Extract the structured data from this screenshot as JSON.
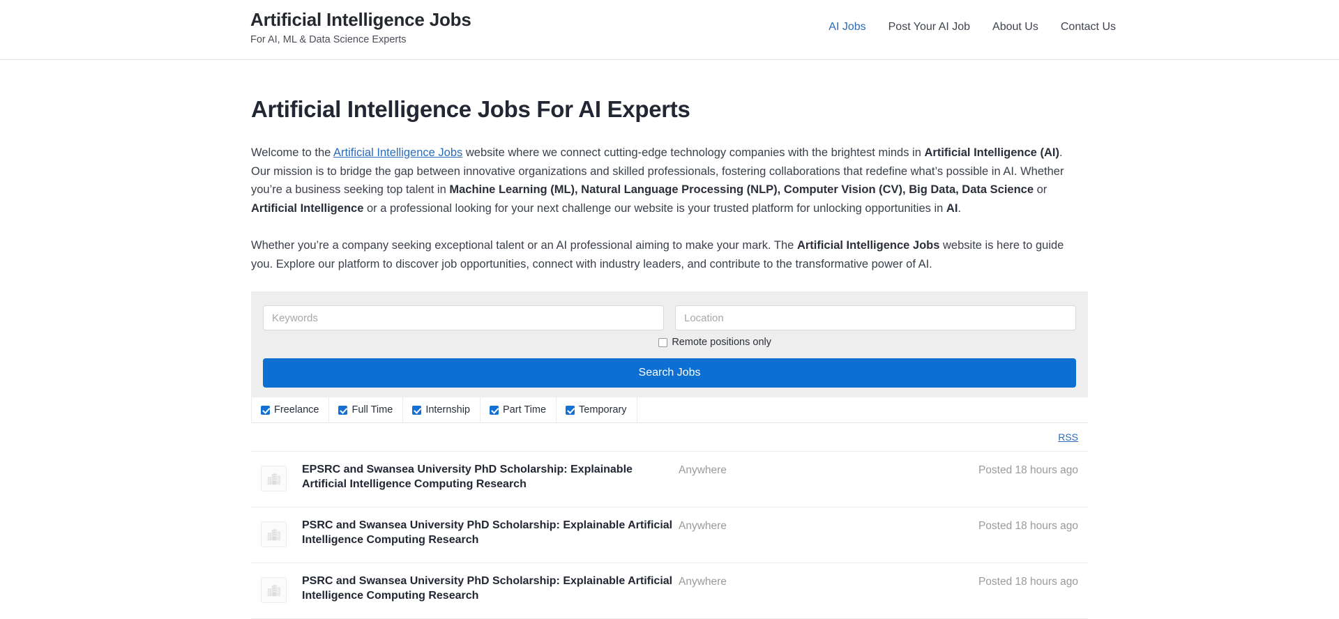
{
  "header": {
    "brand_title": "Artificial Intelligence Jobs",
    "brand_tagline": "For AI, ML & Data Science Experts",
    "nav": [
      {
        "label": "AI Jobs",
        "active": true
      },
      {
        "label": "Post Your AI Job",
        "active": false
      },
      {
        "label": "About Us",
        "active": false
      },
      {
        "label": "Contact Us",
        "active": false
      }
    ]
  },
  "main": {
    "page_title": "Artificial Intelligence Jobs For AI Experts",
    "paragraph_1": {
      "t1": "Welcome to the ",
      "link": "Artificial Intelligence Jobs",
      "t2": " website where we connect cutting-edge technology companies with the brightest minds in ",
      "b1": "Artificial Intelligence (AI)",
      "t3": ". Our mission is to bridge the gap between innovative organizations and skilled professionals, fostering collaborations that redefine what’s possible in AI. Whether you’re a business seeking top talent in ",
      "b2": "Machine Learning (ML), Natural Language Processing (NLP), Computer Vision (CV), Big Data, Data Science",
      "t4": " or ",
      "b3": "Artificial Intelligence",
      "t5": " or a professional looking for your next challenge our website is your trusted platform for unlocking opportunities in ",
      "b4": "AI",
      "t6": "."
    },
    "paragraph_2": {
      "t1": "Whether you’re a company seeking exceptional talent or an AI professional aiming to make your mark. The ",
      "b1": "Artificial Intelligence Jobs",
      "t2": " website is here to guide you. Explore our platform to discover job opportunities, connect with industry leaders, and contribute to the transformative power of AI."
    }
  },
  "search": {
    "keywords_placeholder": "Keywords",
    "keywords_value": "",
    "location_placeholder": "Location",
    "location_value": "",
    "remote_label": "Remote positions only",
    "remote_checked": false,
    "submit_label": "Search Jobs",
    "accent_color": "#0d6fd1"
  },
  "filters": [
    {
      "label": "Freelance",
      "checked": true
    },
    {
      "label": "Full Time",
      "checked": true
    },
    {
      "label": "Internship",
      "checked": true
    },
    {
      "label": "Part Time",
      "checked": true
    },
    {
      "label": "Temporary",
      "checked": true
    }
  ],
  "rss": {
    "label": "RSS"
  },
  "jobs": [
    {
      "title": "EPSRC and Swansea University PhD Scholarship: Explainable Artificial Intelligence Computing Research",
      "location": "Anywhere",
      "posted": "Posted 18 hours ago",
      "logo_icon": "company-placeholder-icon"
    },
    {
      "title": "PSRC and Swansea University PhD Scholarship: Explainable Artificial Intelligence Computing Research",
      "location": "Anywhere",
      "posted": "Posted 18 hours ago",
      "logo_icon": "company-placeholder-icon"
    },
    {
      "title": "PSRC and Swansea University PhD Scholarship: Explainable Artificial Intelligence Computing Research",
      "location": "Anywhere",
      "posted": "Posted 18 hours ago",
      "logo_icon": "company-placeholder-icon"
    }
  ]
}
